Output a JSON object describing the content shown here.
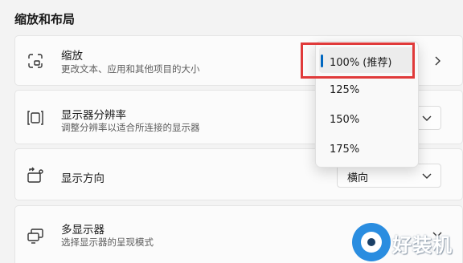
{
  "section_title": "缩放和布局",
  "rows": {
    "scale": {
      "title": "缩放",
      "subtitle": "更改文本、应用和其他项目的大小",
      "icon": "scale-icon"
    },
    "resolution": {
      "title": "显示器分辨率",
      "subtitle": "调整分辨率以适合所连接的显示器",
      "icon": "resolution-icon"
    },
    "orientation": {
      "title": "显示方向",
      "value": "横向",
      "icon": "orientation-icon"
    },
    "multi_display": {
      "title": "多显示器",
      "subtitle": "选择显示器的呈现模式",
      "icon": "multi-display-icon"
    }
  },
  "scale_dropdown": {
    "options": [
      "100% (推荐)",
      "125%",
      "150%",
      "175%"
    ],
    "selected": "100% (推荐)"
  },
  "colors": {
    "accent": "#0067c0",
    "highlight": "#e03a3a",
    "watermark": "#2a8de0"
  },
  "watermark": {
    "text": "好装机"
  }
}
